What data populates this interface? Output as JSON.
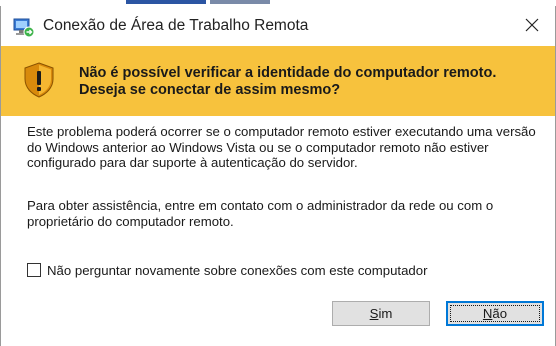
{
  "window": {
    "title": "Conexão de Área de Trabalho Remota",
    "close_symbol": "✕"
  },
  "banner": {
    "heading": "Não é possível verificar a identidade do computador remoto. Deseja se conectar de assim mesmo?",
    "icon": "warning-shield-icon"
  },
  "content": {
    "paragraph1": "Este problema poderá ocorrer se o computador remoto estiver executando uma versão do Windows anterior ao Windows Vista ou se o computador remoto não estiver configurado para dar suporte à autenticação do servidor.",
    "paragraph2": "Para obter assistência, entre em contato com o administrador da rede ou com o proprietário do computador remoto.",
    "checkbox_label": "Não perguntar novamente sobre conexões com este computador",
    "checkbox_checked": false
  },
  "buttons": {
    "yes_label": "Sim",
    "no_label": "Não"
  },
  "colors": {
    "banner": "#f7c23d",
    "focus_border": "#0078d7",
    "button_face": "#e1e1e1"
  }
}
